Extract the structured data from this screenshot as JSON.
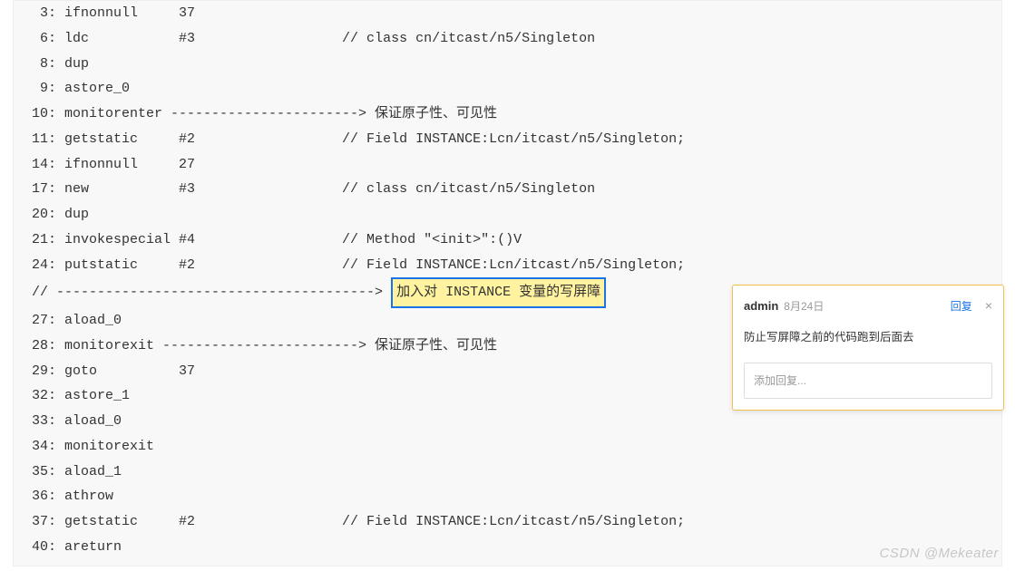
{
  "code": {
    "lines": [
      " 3: ifnonnull     37",
      " 6: ldc           #3                  // class cn/itcast/n5/Singleton",
      " 8: dup",
      " 9: astore_0",
      "10: monitorenter -----------------------> 保证原子性、可见性",
      "11: getstatic     #2                  // Field INSTANCE:Lcn/itcast/n5/Singleton;",
      "14: ifnonnull     27",
      "17: new           #3                  // class cn/itcast/n5/Singleton",
      "20: dup",
      "21: invokespecial #4                  // Method \"<init>\":()V",
      "24: putstatic     #2                  // Field INSTANCE:Lcn/itcast/n5/Singleton;"
    ],
    "highlight_prefix": "// --------------------------------------->",
    "highlight_text": "加入对 INSTANCE 变量的写屏障",
    "lines_after": [
      "27: aload_0",
      "28: monitorexit ------------------------> 保证原子性、可见性",
      "29: goto          37",
      "32: astore_1",
      "33: aload_0",
      "34: monitorexit",
      "35: aload_1",
      "36: athrow",
      "37: getstatic     #2                  // Field INSTANCE:Lcn/itcast/n5/Singleton;",
      "40: areturn"
    ]
  },
  "comment": {
    "author": "admin",
    "date": "8月24日",
    "reply_label": "回复",
    "close_label": "×",
    "body": "防止写屏障之前的代码跑到后面去",
    "reply_placeholder": "添加回复..."
  },
  "watermark": "CSDN @Mekeater"
}
